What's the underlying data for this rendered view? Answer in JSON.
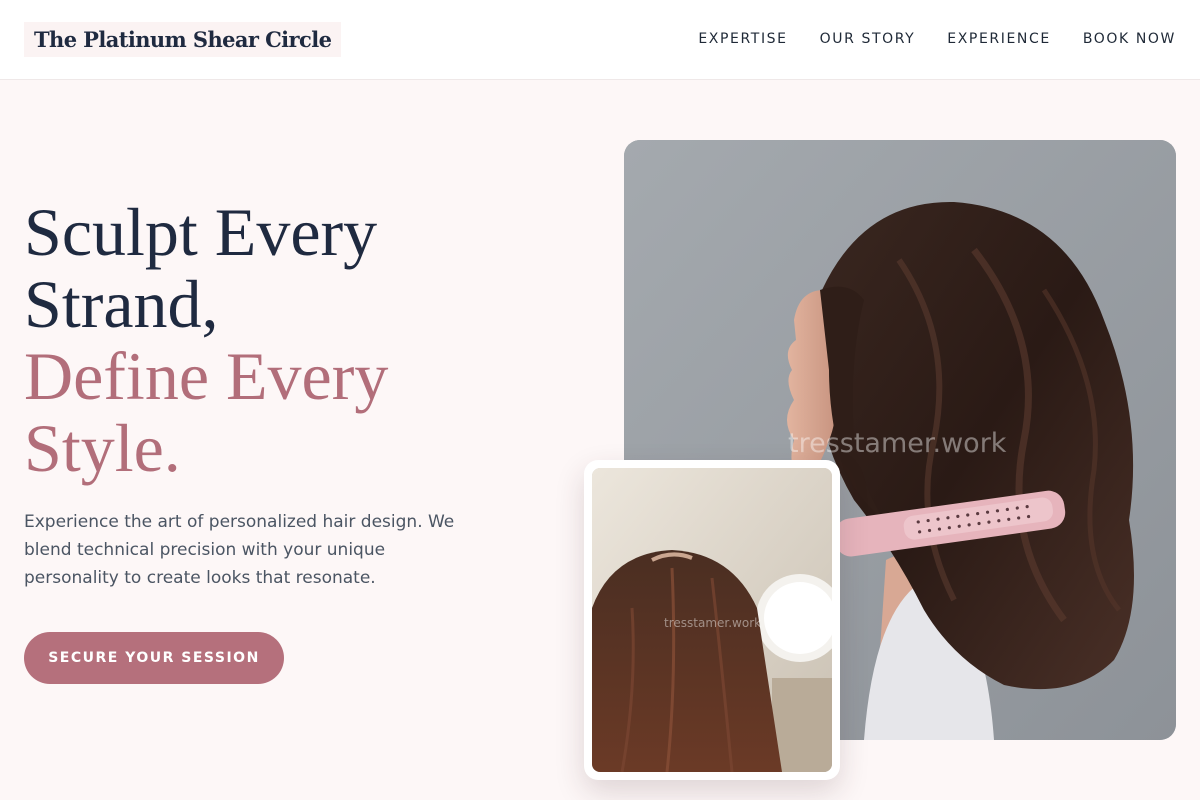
{
  "brand": {
    "name": "The Platinum Shear Circle"
  },
  "nav": {
    "items": [
      {
        "label": "EXPERTISE"
      },
      {
        "label": "OUR STORY"
      },
      {
        "label": "EXPERIENCE"
      },
      {
        "label": "BOOK NOW"
      }
    ]
  },
  "hero": {
    "headline_dark_1": "Sculpt Every",
    "headline_dark_2": "Strand,",
    "headline_accent_1": "Define Every",
    "headline_accent_2": "Style.",
    "intro": "Experience the art of personalized hair design. We blend technical precision with your unique personality to create looks that resonate.",
    "cta_label": "SECURE YOUR SESSION"
  },
  "images": {
    "main_watermark": "tresstamer.work",
    "detail_watermark": "tresstamer.work"
  },
  "colors": {
    "page_background": "#fdf7f7",
    "heading": "#1f2a40",
    "accent": "#b26e7a",
    "button": "#b5707c",
    "body_text": "#4b5563"
  }
}
